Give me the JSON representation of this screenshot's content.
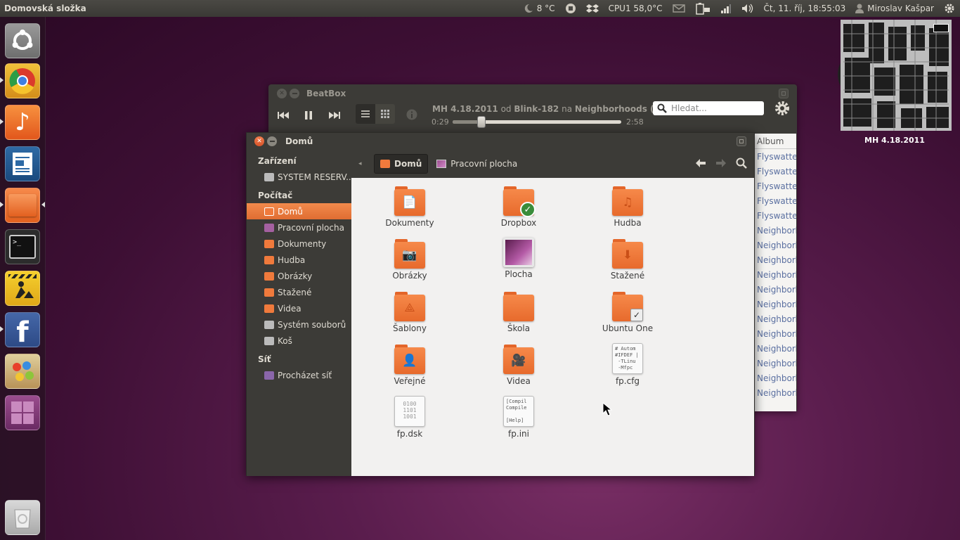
{
  "top_panel": {
    "title": "Domovská složka",
    "weather": "8 °C",
    "cpu": "CPU1 58,0°C",
    "datetime": "Čt, 11. říj, 18:55:03",
    "user": "Miroslav Kašpar",
    "icons": [
      "weather-night-icon",
      "evernote-icon",
      "dropbox-icon",
      "mail-icon",
      "battery-icon",
      "network-icon",
      "volume-icon",
      "user-icon",
      "gear-icon"
    ]
  },
  "launcher": {
    "items": [
      "ubuntu-dash",
      "chrome",
      "music-player",
      "libreoffice-writer",
      "files",
      "terminal",
      "construction",
      "facebook",
      "paint",
      "workspace-switcher",
      "trash"
    ]
  },
  "album": {
    "label": "MH 4.18.2011"
  },
  "beatbox": {
    "title": "BeatBox",
    "now_playing_track": "MH 4.18.2011",
    "now_playing_od": "od",
    "now_playing_artist": "Blink-182",
    "now_playing_na": "na",
    "now_playing_album": "Neighborhoods (Delu...",
    "time_elapsed": "0:29",
    "time_total": "2:58",
    "progress": 0.17,
    "search_placeholder": "Hledat...",
    "column_header": "Album",
    "album_cells": [
      "Flyswatter",
      "Flyswatter",
      "Flyswatter",
      "Flyswatter",
      "Flyswatter",
      "Neighborh",
      "Neighborh",
      "Neighborh",
      "Neighborh",
      "Neighborh",
      "Neighborh",
      "Neighborh",
      "Neighborh",
      "Neighborh",
      "Neighborh",
      "Neighborh",
      "Neighborh"
    ]
  },
  "nautilus": {
    "title": "Domů",
    "sidebar": {
      "sections": [
        {
          "heading": "Zařízení",
          "items": [
            {
              "label": "SYSTEM RESERV...",
              "icon": "drive-icon"
            }
          ]
        },
        {
          "heading": "Počítač",
          "items": [
            {
              "label": "Domů",
              "icon": "home-folder-icon",
              "selected": true
            },
            {
              "label": "Pracovní plocha",
              "icon": "desktop-icon"
            },
            {
              "label": "Dokumenty",
              "icon": "documents-folder-icon"
            },
            {
              "label": "Hudba",
              "icon": "music-folder-icon"
            },
            {
              "label": "Obrázky",
              "icon": "pictures-folder-icon"
            },
            {
              "label": "Stažené",
              "icon": "downloads-folder-icon"
            },
            {
              "label": "Videa",
              "icon": "videos-folder-icon"
            },
            {
              "label": "Systém souborů",
              "icon": "filesystem-icon"
            },
            {
              "label": "Koš",
              "icon": "trash-icon"
            }
          ]
        },
        {
          "heading": "Síť",
          "items": [
            {
              "label": "Procházet síť",
              "icon": "network-icon"
            }
          ]
        }
      ]
    },
    "breadcrumbs": [
      {
        "label": "Domů",
        "active": true
      },
      {
        "label": "Pracovní plocha",
        "active": false
      }
    ],
    "files": [
      {
        "name": "Dokumenty",
        "kind": "folder",
        "emblem": "📄"
      },
      {
        "name": "Dropbox",
        "kind": "folder",
        "emblem": ""
      },
      {
        "name": "Hudba",
        "kind": "folder",
        "emblem": "♫"
      },
      {
        "name": "Obrázky",
        "kind": "folder",
        "emblem": "📷"
      },
      {
        "name": "Plocha",
        "kind": "desktop",
        "emblem": ""
      },
      {
        "name": "Stažené",
        "kind": "folder",
        "emblem": "⬇"
      },
      {
        "name": "Šablony",
        "kind": "folder",
        "emblem": "⟁"
      },
      {
        "name": "Škola",
        "kind": "folder",
        "emblem": ""
      },
      {
        "name": "Ubuntu One",
        "kind": "folder",
        "emblem": ""
      },
      {
        "name": "Veřejné",
        "kind": "folder",
        "emblem": "👤"
      },
      {
        "name": "Videa",
        "kind": "folder",
        "emblem": "🎥"
      },
      {
        "name": "fp.cfg",
        "kind": "text",
        "preview": "# Autom\n#IFDEF |\n -TLinu\n -Mfpc"
      },
      {
        "name": "fp.dsk",
        "kind": "binary",
        "preview": "0100\n1101\n1001"
      },
      {
        "name": "fp.ini",
        "kind": "text",
        "preview": "[Compil\nCompile\n\n[Help]"
      }
    ]
  },
  "colors": {
    "accent": "#e76a2c",
    "panel": "#3c3b37",
    "selection": "#f07a3c"
  }
}
